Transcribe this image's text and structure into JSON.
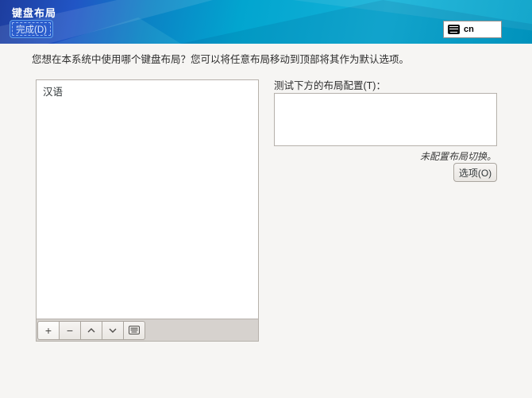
{
  "header": {
    "title": "键盘布局",
    "done_button_label": "完成(D)",
    "keyboard_indicator": {
      "icon": "keyboard-icon",
      "label": "cn"
    }
  },
  "instruction": "您想在本系统中使用哪个键盘布局？您可以将任意布局移动到顶部将其作为默认选项。",
  "layout_list": {
    "items": [
      "汉语"
    ],
    "toolbar_buttons": [
      {
        "name": "add-layout-button",
        "icon": "plus-icon",
        "glyph": "+"
      },
      {
        "name": "remove-layout-button",
        "icon": "minus-icon",
        "glyph": "−"
      },
      {
        "name": "move-up-button",
        "icon": "chevron-up-icon"
      },
      {
        "name": "move-down-button",
        "icon": "chevron-down-icon"
      },
      {
        "name": "preview-layout-button",
        "icon": "keyboard-icon"
      }
    ]
  },
  "test_area": {
    "label": "测试下方的布局配置(T)：",
    "textarea_value": "",
    "note": "未配置布局切换。",
    "options_button_label": "选项(O)"
  },
  "colors": {
    "banner_blue_left": "#1d3d9e",
    "banner_cyan": "#04a9d2",
    "done_button_bg": "#2a5ccc",
    "done_button_border": "#5f9fe8",
    "content_background": "#f6f5f3",
    "widget_border": "#b6b1ab",
    "toolbar_background": "#d6d2ce",
    "text": "#2e3436"
  }
}
